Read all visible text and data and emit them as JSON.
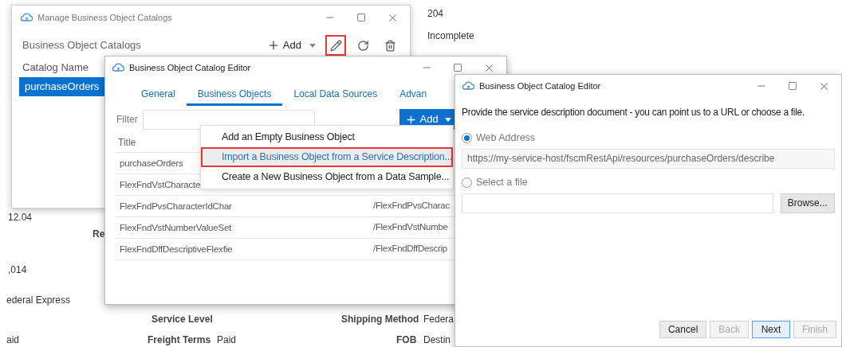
{
  "background": {
    "texts": [
      {
        "text": "204",
        "bold": false
      },
      {
        "text": "Incomplete",
        "bold": false
      },
      {
        "text": "12.04",
        "bold": false
      },
      {
        "text": "Re",
        "bold": true
      },
      {
        "text": ",014",
        "bold": false
      },
      {
        "text": "ederal Express",
        "bold": false
      },
      {
        "text": "Service Level",
        "bold": true
      },
      {
        "text": "Shipping Method",
        "bold": true
      },
      {
        "text": "Federa",
        "bold": false
      },
      {
        "text": "aid",
        "bold": false
      },
      {
        "text": "Freight Terms",
        "bold": true
      },
      {
        "text": "Paid",
        "bold": false
      },
      {
        "text": "FOB",
        "bold": true
      },
      {
        "text": "Destin",
        "bold": false
      }
    ]
  },
  "catalogs_window": {
    "title": "Manage Business Object Catalogs",
    "heading": "Business Object Catalogs",
    "toolbar": [
      {
        "kind": "add",
        "label": "Add",
        "highlighted": false
      },
      {
        "kind": "edit",
        "highlighted": true
      },
      {
        "kind": "refresh",
        "highlighted": false
      },
      {
        "kind": "delete",
        "highlighted": false
      }
    ],
    "table": {
      "column": "Catalog Name",
      "rows": [
        {
          "name": "purchaseOrders",
          "selected": true
        }
      ]
    }
  },
  "editor_window": {
    "title": "Business Object Catalog Editor",
    "tabs": [
      {
        "label": "General",
        "selected": false
      },
      {
        "label": "Business Objects",
        "selected": true
      },
      {
        "label": "Local Data Sources",
        "selected": false
      },
      {
        "label": "Advan",
        "selected": false
      }
    ],
    "filter_label": "Filter",
    "add_button": "Add",
    "table": {
      "column": "Title",
      "rows": [
        {
          "title": "purchaseOrders"
        },
        {
          "title": "FlexFndVstCharacte"
        },
        {
          "title": "FlexFndPvsCharacterIdChar",
          "column_2": "/FlexFndPvsCharac"
        },
        {
          "title": "FlexFndVstNumberValueSet",
          "column_2": "/FlexFndVstNumbe"
        },
        {
          "title": "FlexFndDffDescriptiveFlexfie",
          "column_2": "/FlexFndDffDescrip"
        }
      ]
    },
    "menu": [
      {
        "label": "Add an Empty Business Object",
        "highlighted": false
      },
      {
        "label": "Import a Business Object from a Service Description...",
        "highlighted": true
      },
      {
        "label": "Create a New Business Object from a Data Sample...",
        "highlighted": false
      }
    ]
  },
  "service_window": {
    "title": "Business Object Catalog Editor",
    "instructions": "Provide the service description document - you can point us to a URL or choose a file.",
    "options": [
      {
        "label": "Web Address",
        "selected": true,
        "value": "https://my-service-host/fscmRestApi/resources/purchaseOrders/describe"
      },
      {
        "label": "Select a file",
        "selected": false
      }
    ],
    "browse_button": "Browse...",
    "buttons": [
      {
        "label": "Cancel",
        "disabled": false,
        "focused": false
      },
      {
        "label": "Back",
        "disabled": true,
        "focused": false
      },
      {
        "label": "Next",
        "disabled": false,
        "focused": true
      },
      {
        "label": "Finish",
        "disabled": true,
        "focused": false
      }
    ]
  }
}
